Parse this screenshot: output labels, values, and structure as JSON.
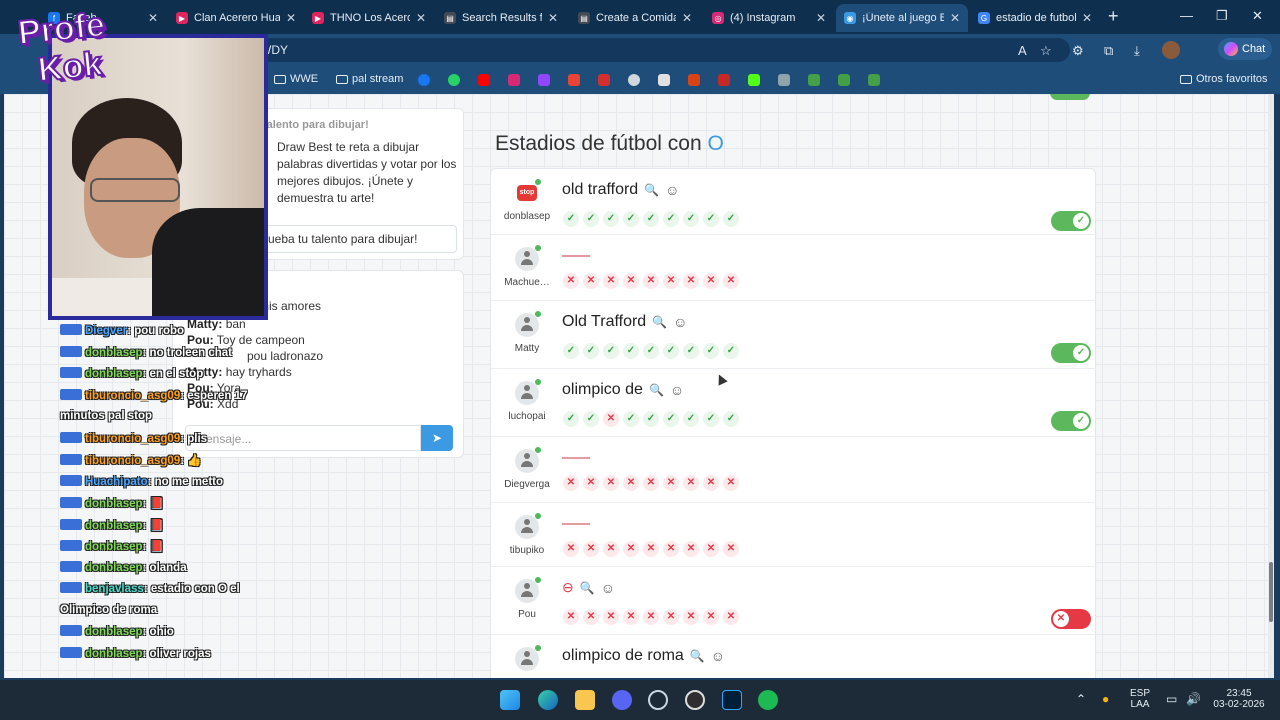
{
  "browser": {
    "tabs": [
      {
        "label": "Faceb",
        "icon_color": "#1877f2"
      },
      {
        "label": "Clan Acerero Huach",
        "icon_color": "#e0245e"
      },
      {
        "label": "THNO Los Aceroos",
        "icon_color": "#e0245e"
      },
      {
        "label": "Search Results for",
        "icon_color": "#444b55"
      },
      {
        "label": "Create a Comida Cl",
        "icon_color": "#444b55"
      },
      {
        "label": "(4) Instagram",
        "icon_color": "#d62976"
      },
      {
        "label": "¡Únete al juego Bas",
        "icon_color": "#3b9ae1"
      },
      {
        "label": "estadio de futbol c",
        "icon_color": "#4285f4"
      }
    ],
    "url_fragment": "WDY",
    "chat_label": "Chat",
    "bookmarks": {
      "wwe": "WWE",
      "pal_stream": "pal stream",
      "other": "Otros favoritos"
    }
  },
  "left_card": {
    "header": "talento para dibujar!",
    "description": "Draw Best te reta a dibujar palabras divertidas y votar por los mejores dibujos. ¡Únete y demuestra tu arte!",
    "cta": "ueba tu talento para dibujar!"
  },
  "chat": {
    "messages": [
      {
        "user": "",
        "text": "mis amores"
      },
      {
        "user": "Matty:",
        "text": "ban"
      },
      {
        "user": "Pou:",
        "text": "Toy de campeon"
      },
      {
        "user": "",
        "text": "pou ladronazo"
      },
      {
        "user": "Matty:",
        "text": "hay tryhards"
      },
      {
        "user": "Pou:",
        "text": "Yora"
      },
      {
        "user": "Pou:",
        "text": "Xdd"
      }
    ],
    "input_placeholder": "Mensaje..."
  },
  "game": {
    "heading": "Estadios de fútbol con",
    "letter": "O",
    "rows": [
      {
        "user": "donblasep",
        "answer": "old trafford",
        "avatar": "stop",
        "marks": "ooooooooo",
        "toggle": "on"
      },
      {
        "user": "Machue…",
        "answer": "",
        "avatar": "person",
        "marks": "xxxxxxxxx",
        "toggle": ""
      },
      {
        "user": "Matty",
        "answer": "Old Trafford",
        "avatar": "person",
        "marks": "ooooooooo",
        "toggle": "on"
      },
      {
        "user": "luchopai",
        "answer": "olimpico de",
        "avatar": "person",
        "marks": "ooxoooooo",
        "toggle": "on"
      },
      {
        "user": "Diegverga",
        "answer": "",
        "avatar": "person",
        "marks": "xxxxxxxxx",
        "toggle": ""
      },
      {
        "user": "tibupiko",
        "answer": "",
        "avatar": "person",
        "marks": "xxxxxxxxx",
        "toggle": ""
      },
      {
        "user": "Pou",
        "answer": "⊖",
        "avatar": "person",
        "marks": "xxxxxxxxx",
        "toggle": "off"
      },
      {
        "user": "",
        "answer": "olimpico de roma",
        "avatar": "person",
        "marks": "",
        "toggle": ""
      }
    ]
  },
  "stream_overlay": {
    "logo_line1": "Profe",
    "logo_line2": "Kok",
    "chat": [
      {
        "user": "Diegver",
        "text": ": pou robo",
        "color": "#4aa3ff"
      },
      {
        "user": "donblasep",
        "text": ": no troleen chat",
        "color": "#7ed957"
      },
      {
        "user": "donblasep",
        "text": ": en el stop",
        "color": "#7ed957"
      },
      {
        "user": "tiburoncio_asg09",
        "text": ": esperen 17",
        "color": "#ff9f1a"
      },
      {
        "user": "",
        "text": "minutos pal stop",
        "color": "#fff"
      },
      {
        "user": "tiburoncio_asg09",
        "text": ": plis",
        "color": "#ff9f1a"
      },
      {
        "user": "tiburoncio_asg09",
        "text": ": 👍",
        "color": "#ff9f1a"
      },
      {
        "user": "Huachipato",
        "text": ": no me metto",
        "color": "#4aa3ff"
      },
      {
        "user": "donblasep",
        "text": ": 📕",
        "color": "#7ed957"
      },
      {
        "user": "donblasep",
        "text": ": 📕",
        "color": "#7ed957"
      },
      {
        "user": "donblasep",
        "text": ": 📕",
        "color": "#7ed957"
      },
      {
        "user": "donblasep",
        "text": ": olanda",
        "color": "#7ed957"
      },
      {
        "user": "benjavlass",
        "text": ": estadio con O el",
        "color": "#4ad9c9"
      },
      {
        "user": "",
        "text": "Olimpico de roma",
        "color": "#fff"
      },
      {
        "user": "donblasep",
        "text": ": ohio",
        "color": "#7ed957"
      },
      {
        "user": "donblasep",
        "text": ": oliver rojas",
        "color": "#7ed957"
      }
    ]
  },
  "taskbar": {
    "lang": "ESP",
    "region": "LAA",
    "time": "23:45",
    "date": "03-02-2026"
  }
}
